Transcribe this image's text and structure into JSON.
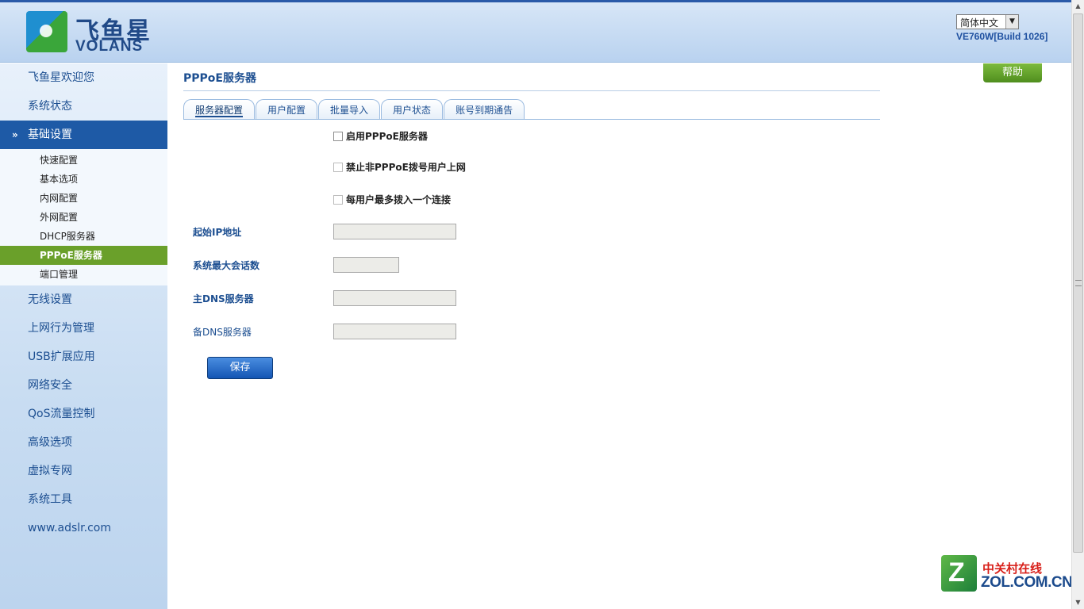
{
  "header": {
    "logo_cn": "飞鱼星",
    "logo_en": "VOLANS",
    "language": "简体中文",
    "build": "VE760W[Build 1026]"
  },
  "sidebar": {
    "top_items": [
      {
        "label": "飞鱼星欢迎您"
      },
      {
        "label": "系统状态"
      }
    ],
    "section": {
      "label": "基础设置",
      "icon": "double-chevron-down-icon"
    },
    "sub_items": [
      {
        "label": "快速配置"
      },
      {
        "label": "基本选项"
      },
      {
        "label": "内网配置"
      },
      {
        "label": "外网配置"
      },
      {
        "label": "DHCP服务器"
      },
      {
        "label": "PPPoE服务器",
        "active": true
      },
      {
        "label": "端口管理"
      }
    ],
    "bottom_items": [
      {
        "label": "无线设置"
      },
      {
        "label": "上网行为管理"
      },
      {
        "label": "USB扩展应用"
      },
      {
        "label": "网络安全"
      },
      {
        "label": "QoS流量控制"
      },
      {
        "label": "高级选项"
      },
      {
        "label": "虚拟专网"
      },
      {
        "label": "系统工具"
      },
      {
        "label": "www.adslr.com"
      }
    ]
  },
  "main": {
    "title": "PPPoE服务器",
    "help_label": "帮助",
    "tabs": [
      {
        "label": "服务器配置",
        "active": true
      },
      {
        "label": "用户配置"
      },
      {
        "label": "批量导入"
      },
      {
        "label": "用户状态"
      },
      {
        "label": "账号到期通告"
      }
    ],
    "checkboxes": [
      {
        "label": "启用PPPoE服务器",
        "checked": false
      },
      {
        "label": "禁止非PPPoE拨号用户上网",
        "checked": false
      },
      {
        "label": "每用户最多拨入一个连接",
        "checked": false
      }
    ],
    "fields": [
      {
        "label": "起始IP地址",
        "value": ""
      },
      {
        "label": "系统最大会话数",
        "value": ""
      },
      {
        "label": "主DNS服务器",
        "value": ""
      },
      {
        "label": "备DNS服务器",
        "value": ""
      }
    ],
    "save_label": "保存"
  },
  "watermark": {
    "cn": "中关村在线",
    "en": "ZOL.COM.CN"
  },
  "colors": {
    "accent_blue": "#1e5aa6",
    "active_green": "#6aa02a",
    "help_green": "#5f9e2a"
  }
}
